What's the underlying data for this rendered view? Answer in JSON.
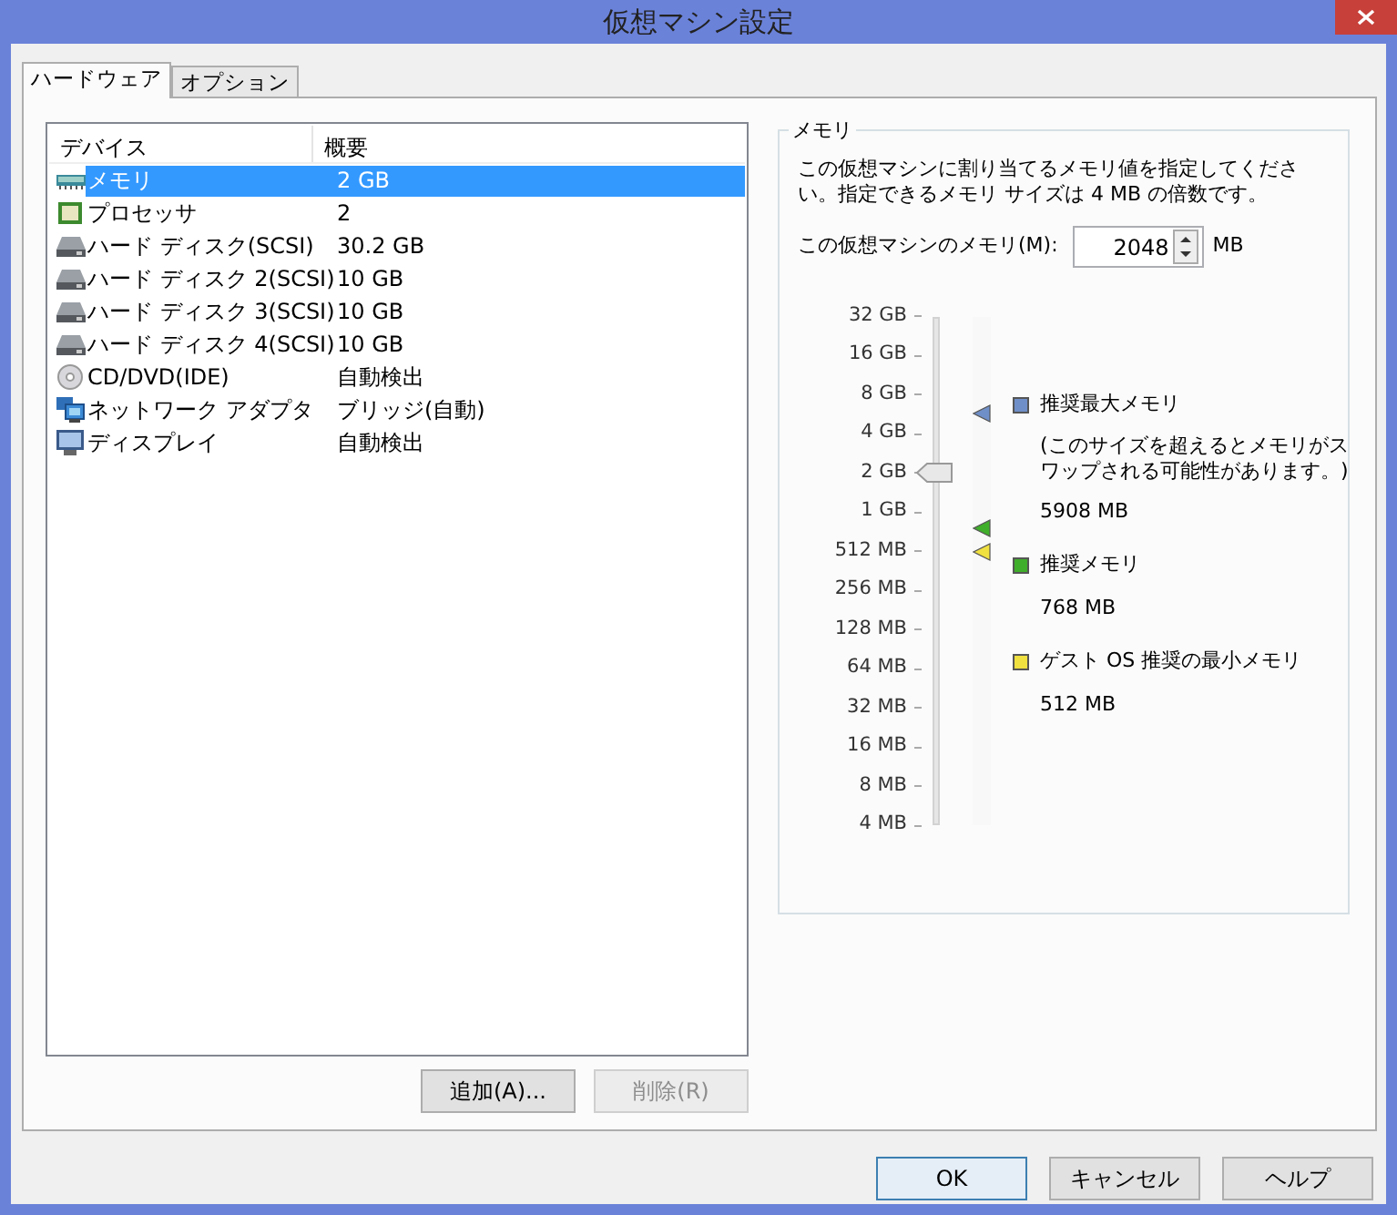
{
  "window": {
    "title": "仮想マシン設定"
  },
  "tabs": [
    {
      "label": "ハードウェア",
      "selected": true
    },
    {
      "label": "オプション",
      "selected": false
    }
  ],
  "devices": {
    "columns": [
      "デバイス",
      "概要"
    ],
    "rows": [
      {
        "kind": "memory",
        "device": "メモリ",
        "summary": "2 GB",
        "selected": true
      },
      {
        "kind": "processor",
        "device": "プロセッサ",
        "summary": "2",
        "selected": false
      },
      {
        "kind": "disk",
        "device": "ハード ディスク(SCSI)",
        "summary": "30.2 GB",
        "selected": false
      },
      {
        "kind": "disk",
        "device": "ハード ディスク 2(SCSI)",
        "summary": "10 GB",
        "selected": false
      },
      {
        "kind": "disk",
        "device": "ハード ディスク 3(SCSI)",
        "summary": "10 GB",
        "selected": false
      },
      {
        "kind": "disk",
        "device": "ハード ディスク 4(SCSI)",
        "summary": "10 GB",
        "selected": false
      },
      {
        "kind": "cd",
        "device": "CD/DVD(IDE)",
        "summary": "自動検出",
        "selected": false
      },
      {
        "kind": "network",
        "device": "ネットワーク アダプタ",
        "summary": "ブリッジ(自動)",
        "selected": false
      },
      {
        "kind": "display",
        "device": "ディスプレイ",
        "summary": "自動検出",
        "selected": false
      }
    ],
    "buttons": [
      {
        "label": "追加(A)...",
        "disabled": false
      },
      {
        "label": "削除(R)",
        "disabled": true
      }
    ]
  },
  "memory": {
    "title": "メモリ",
    "description": "この仮想マシンに割り当てるメモリ値を指定してください。指定できるメモリ サイズは 4 MB の倍数です。",
    "field_label": "この仮想マシンのメモリ(M):",
    "value": "2048",
    "unit": "MB",
    "slider": {
      "level": 0.692,
      "ticks": [
        "32 GB",
        "16 GB",
        "8 GB",
        "4 GB",
        "2 GB",
        "1 GB",
        "512 MB",
        "256 MB",
        "128 MB",
        "64 MB",
        "32 MB",
        "16 MB",
        "8 MB",
        "4 MB"
      ]
    },
    "legend": [
      {
        "color": "#6f8fc8",
        "title": "推奨最大メモリ",
        "note": "(このサイズを超えるとメモリがスワップされる可能性があります。)",
        "value": "5908 MB",
        "level": 0.81
      },
      {
        "color": "#3fae2a",
        "title": "推奨メモリ",
        "value": "768 MB",
        "level": 0.583
      },
      {
        "color": "#f0e040",
        "title": "ゲスト OS 推奨の最小メモリ",
        "value": "512 MB",
        "level": 0.538
      }
    ]
  },
  "footer_buttons": [
    {
      "label": "OK",
      "selected": true
    },
    {
      "label": "キャンセル",
      "selected": false
    },
    {
      "label": "ヘルプ",
      "selected": false
    }
  ]
}
